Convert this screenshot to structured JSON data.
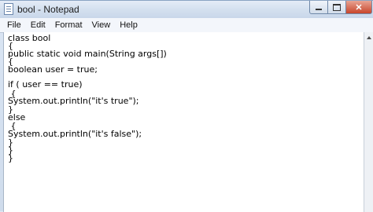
{
  "window": {
    "title": "bool - Notepad"
  },
  "menu": {
    "items": [
      "File",
      "Edit",
      "Format",
      "View",
      "Help"
    ]
  },
  "editor": {
    "lines": [
      "class bool",
      "{",
      "public static void main(String args[])",
      "{",
      "boolean user = true;",
      "",
      "if ( user == true)",
      " {",
      "System.out.println(\"it's true\");",
      "}",
      "else",
      " {",
      "System.out.println(\"it's false\");",
      "}",
      "}",
      "}"
    ]
  },
  "icons": {
    "app": "notepad-icon",
    "minimize": "minimize-icon",
    "maximize": "maximize-icon",
    "close": "close-icon",
    "scroll_up": "scroll-up-arrow-icon"
  }
}
